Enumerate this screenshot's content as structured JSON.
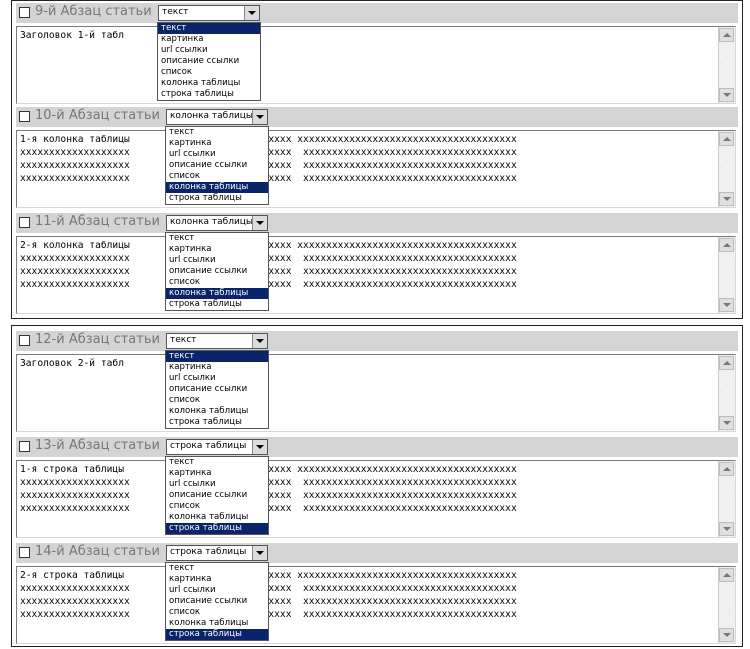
{
  "options": [
    "текст",
    "картинка",
    "url ссылки",
    "описание ссылки",
    "список",
    "колонка таблицы",
    "строка таблицы"
  ],
  "sections": [
    {
      "title": "9-й Абзац статьи",
      "selected": "текст",
      "selected_index": 0,
      "content": "Заголовок 1-й табл"
    },
    {
      "title": "10-й Абзац статьи",
      "selected": "колонка таблицы",
      "selected_index": 5,
      "content": "1-я колонка таблицы                  xxxxxxxxxx xxxxxxxxxxxxxxxxxxxxxxxxxxxxxxxxxxxxxx\nxxxxxxxxxxxxxxxxxxx                  xxxxxxxxxx  xxxxxxxxxxxxxxxxxxxxxxxxxxxxxxxxxxxxx\nxxxxxxxxxxxxxxxxxxx                  xxxxxxxxxx  xxxxxxxxxxxxxxxxxxxxxxxxxxxxxxxxxxxxx\nxxxxxxxxxxxxxxxxxxx                  xxxxxxxxxx  xxxxxxxxxxxxxxxxxxxxxxxxxxxxxxxxxxxxx"
    },
    {
      "title": "11-й Абзац статьи",
      "selected": "колонка таблицы",
      "selected_index": 5,
      "content": "2-я колонка таблицы                  xxxxxxxxxx xxxxxxxxxxxxxxxxxxxxxxxxxxxxxxxxxxxxxx\nxxxxxxxxxxxxxxxxxxx                  xxxxxxxxxx  xxxxxxxxxxxxxxxxxxxxxxxxxxxxxxxxxxxxx\nxxxxxxxxxxxxxxxxxxx                  xxxxxxxxxx  xxxxxxxxxxxxxxxxxxxxxxxxxxxxxxxxxxxxx\nxxxxxxxxxxxxxxxxxxx                  xxxxxxxxxx  xxxxxxxxxxxxxxxxxxxxxxxxxxxxxxxxxxxxx"
    },
    {
      "title": "12-й Абзац статьи",
      "selected": "текст",
      "selected_index": 0,
      "content": "Заголовок 2-й табл"
    },
    {
      "title": "13-й Абзац статьи",
      "selected": "строка таблицы",
      "selected_index": 6,
      "content": "1-я строка таблицы                   xxxxxxxxxx xxxxxxxxxxxxxxxxxxxxxxxxxxxxxxxxxxxxxx\nxxxxxxxxxxxxxxxxxxx                  xxxxxxxxxx  xxxxxxxxxxxxxxxxxxxxxxxxxxxxxxxxxxxxx\nxxxxxxxxxxxxxxxxxxx                  xxxxxxxxxx  xxxxxxxxxxxxxxxxxxxxxxxxxxxxxxxxxxxxx\nxxxxxxxxxxxxxxxxxxx                  xxxxxxxxxx  xxxxxxxxxxxxxxxxxxxxxxxxxxxxxxxxxxxxx"
    },
    {
      "title": "14-й Абзац статьи",
      "selected": "строка таблицы",
      "selected_index": 6,
      "content": "2-я строка таблицы                   xxxxxxxxxx xxxxxxxxxxxxxxxxxxxxxxxxxxxxxxxxxxxxxx\nxxxxxxxxxxxxxxxxxxx                  xxxxxxxxxx  xxxxxxxxxxxxxxxxxxxxxxxxxxxxxxxxxxxxx\nxxxxxxxxxxxxxxxxxxx                  xxxxxxxxxx  xxxxxxxxxxxxxxxxxxxxxxxxxxxxxxxxxxxxx\nxxxxxxxxxxxxxxxxxxx                  xxxxxxxxxx  xxxxxxxxxxxxxxxxxxxxxxxxxxxxxxxxxxxxx"
    }
  ],
  "colors": {
    "header_bg": "#d4d4d4",
    "selection_bg": "#0a246a",
    "title_text": "#777777"
  }
}
